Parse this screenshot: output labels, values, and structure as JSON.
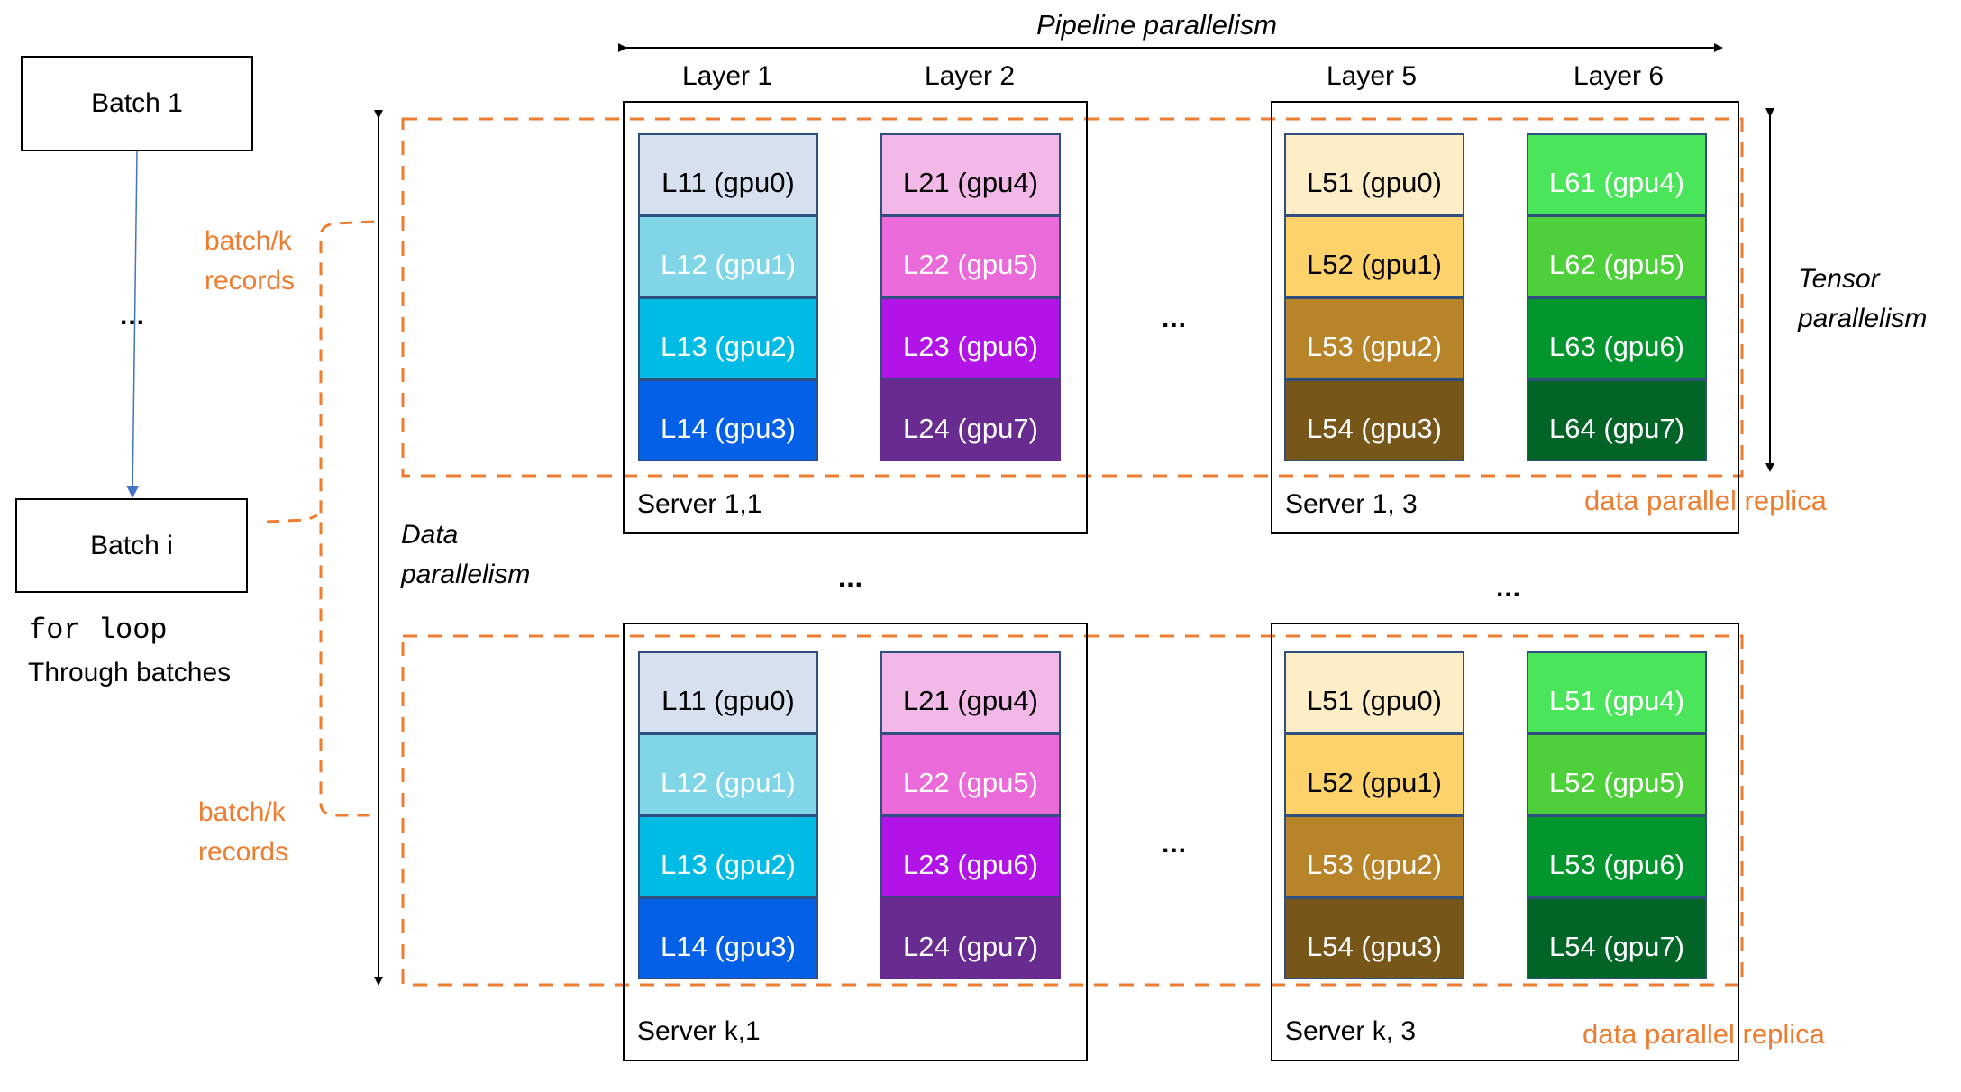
{
  "titles": {
    "pipeline": "Pipeline parallelism",
    "tensor_line1": "Tensor",
    "tensor_line2": "parallelism",
    "data_line1": "Data",
    "data_line2": "parallelism"
  },
  "layers": [
    "Layer 1",
    "Layer 2",
    "Layer 5",
    "Layer 6"
  ],
  "left": {
    "batch1": "Batch 1",
    "batch_i": "Batch i",
    "ellipsis": "...",
    "for_loop": "for loop",
    "through_batches": "Through batches",
    "split_top_line1": "batch/k",
    "split_top_line2": "records",
    "split_bottom_line1": "batch/k",
    "split_bottom_line2": "records"
  },
  "replica_label": "data parallel replica",
  "ellipsis": "...",
  "colors": {
    "accent_orange": "#ed7d31",
    "batch_arrow_blue": "#4472c4",
    "cell_border": "#2f4f7f"
  },
  "servers": [
    {
      "name": "Server 1,1",
      "columns": [
        {
          "cells": [
            {
              "label": "L11 (gpu0)",
              "bg": "#d6e0ef",
              "fg": "#000000"
            },
            {
              "label": "L12 (gpu1)",
              "bg": "#80d6e6",
              "fg": "#ffffff"
            },
            {
              "label": "L13 (gpu2)",
              "bg": "#00bbe3",
              "fg": "#ffffff"
            },
            {
              "label": "L14 (gpu3)",
              "bg": "#0560e8",
              "fg": "#ffffff"
            }
          ]
        },
        {
          "cells": [
            {
              "label": "L21 (gpu4)",
              "bg": "#f1b8e8",
              "fg": "#000000"
            },
            {
              "label": "L22 (gpu5)",
              "bg": "#ea6ada",
              "fg": "#ffffff"
            },
            {
              "label": "L23 (gpu6)",
              "bg": "#b214e8",
              "fg": "#ffffff"
            },
            {
              "label": "L24 (gpu7)",
              "bg": "#682b90",
              "fg": "#ffffff"
            }
          ]
        }
      ]
    },
    {
      "name": "Server 1, 3",
      "columns": [
        {
          "cells": [
            {
              "label": "L51 (gpu0)",
              "bg": "#feeec8",
              "fg": "#000000"
            },
            {
              "label": "L52 (gpu1)",
              "bg": "#fed26a",
              "fg": "#000000"
            },
            {
              "label": "L53 (gpu2)",
              "bg": "#b8842a",
              "fg": "#ffffff"
            },
            {
              "label": "L54 (gpu3)",
              "bg": "#77561a",
              "fg": "#ffffff"
            }
          ]
        },
        {
          "cells": [
            {
              "label": "L61 (gpu4)",
              "bg": "#4ae55a",
              "fg": "#ffffff"
            },
            {
              "label": "L62 (gpu5)",
              "bg": "#4dd03a",
              "fg": "#ffffff"
            },
            {
              "label": "L63 (gpu6)",
              "bg": "#03962e",
              "fg": "#ffffff"
            },
            {
              "label": "L64 (gpu7)",
              "bg": "#036427",
              "fg": "#ffffff"
            }
          ]
        }
      ]
    },
    {
      "name": "Server k,1",
      "columns": [
        {
          "cells": [
            {
              "label": "L11 (gpu0)",
              "bg": "#d6e0ef",
              "fg": "#000000"
            },
            {
              "label": "L12 (gpu1)",
              "bg": "#80d6e6",
              "fg": "#ffffff"
            },
            {
              "label": "L13 (gpu2)",
              "bg": "#00bbe3",
              "fg": "#ffffff"
            },
            {
              "label": "L14 (gpu3)",
              "bg": "#0560e8",
              "fg": "#ffffff"
            }
          ]
        },
        {
          "cells": [
            {
              "label": "L21 (gpu4)",
              "bg": "#f1b8e8",
              "fg": "#000000"
            },
            {
              "label": "L22 (gpu5)",
              "bg": "#ea6ada",
              "fg": "#ffffff"
            },
            {
              "label": "L23 (gpu6)",
              "bg": "#b214e8",
              "fg": "#ffffff"
            },
            {
              "label": "L24 (gpu7)",
              "bg": "#682b90",
              "fg": "#ffffff"
            }
          ]
        }
      ]
    },
    {
      "name": "Server k, 3",
      "columns": [
        {
          "cells": [
            {
              "label": "L51 (gpu0)",
              "bg": "#feeec8",
              "fg": "#000000"
            },
            {
              "label": "L52 (gpu1)",
              "bg": "#fed26a",
              "fg": "#000000"
            },
            {
              "label": "L53 (gpu2)",
              "bg": "#b8842a",
              "fg": "#ffffff"
            },
            {
              "label": "L54 (gpu3)",
              "bg": "#77561a",
              "fg": "#ffffff"
            }
          ]
        },
        {
          "cells": [
            {
              "label": "L51 (gpu4)",
              "bg": "#4ae55a",
              "fg": "#ffffff"
            },
            {
              "label": "L52 (gpu5)",
              "bg": "#4dd03a",
              "fg": "#ffffff"
            },
            {
              "label": "L53 (gpu6)",
              "bg": "#03962e",
              "fg": "#ffffff"
            },
            {
              "label": "L54 (gpu7)",
              "bg": "#036427",
              "fg": "#ffffff"
            }
          ]
        }
      ]
    }
  ]
}
